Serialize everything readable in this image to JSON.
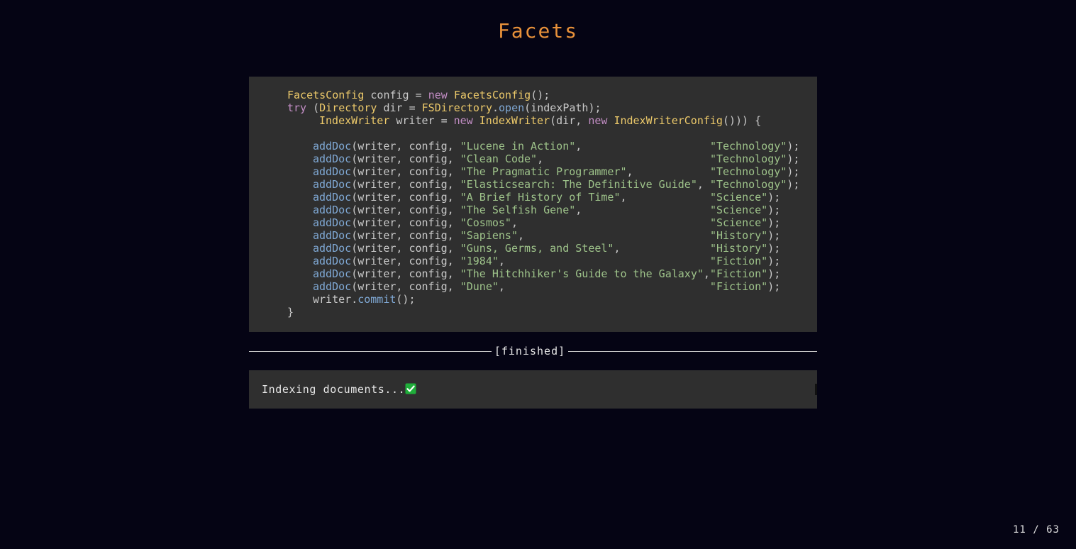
{
  "slide": {
    "title": "Facets",
    "page_counter": "11 / 63"
  },
  "code": {
    "line1": {
      "t1": "FacetsConfig",
      "p1": " config = ",
      "kw1": "new",
      "sp1": " ",
      "t2": "FacetsConfig",
      "p2": "();"
    },
    "line2": {
      "kw1": "try",
      "p1": " (",
      "t1": "Directory",
      "p2": " dir = ",
      "t2": "FSDirectory",
      "p3": ".",
      "f1": "open",
      "p4": "(indexPath);"
    },
    "line3": {
      "t1": "IndexWriter",
      "p1": " writer = ",
      "kw1": "new",
      "sp1": " ",
      "t2": "IndexWriter",
      "p2": "(dir, ",
      "kw2": "new",
      "sp2": " ",
      "t3": "IndexWriterConfig",
      "p3": "())) {"
    },
    "add_doc_fn": "addDoc",
    "add_doc_args": "(writer, config, ",
    "docs": [
      {
        "title": "\"Lucene in Action\"",
        "pad": ",                    ",
        "cat": "\"Technology\"",
        "end": ");"
      },
      {
        "title": "\"Clean Code\"",
        "pad": ",                          ",
        "cat": "\"Technology\"",
        "end": ");"
      },
      {
        "title": "\"The Pragmatic Programmer\"",
        "pad": ",            ",
        "cat": "\"Technology\"",
        "end": ");"
      },
      {
        "title": "\"Elasticsearch: The Definitive Guide\"",
        "pad": ", ",
        "cat": "\"Technology\"",
        "end": ");"
      },
      {
        "title": "\"A Brief History of Time\"",
        "pad": ",             ",
        "cat": "\"Science\"",
        "end": ");"
      },
      {
        "title": "\"The Selfish Gene\"",
        "pad": ",                    ",
        "cat": "\"Science\"",
        "end": ");"
      },
      {
        "title": "\"Cosmos\"",
        "pad": ",                              ",
        "cat": "\"Science\"",
        "end": ");"
      },
      {
        "title": "\"Sapiens\"",
        "pad": ",                             ",
        "cat": "\"History\"",
        "end": ");"
      },
      {
        "title": "\"Guns, Germs, and Steel\"",
        "pad": ",              ",
        "cat": "\"History\"",
        "end": ");"
      },
      {
        "title": "\"1984\"",
        "pad": ",                                ",
        "cat": "\"Fiction\"",
        "end": ");"
      },
      {
        "title": "\"The Hitchhiker's Guide to the Galaxy\"",
        "pad": ",",
        "cat": "\"Fiction\"",
        "end": ");"
      },
      {
        "title": "\"Dune\"",
        "pad": ",                                ",
        "cat": "\"Fiction\"",
        "end": ");"
      }
    ],
    "commit_line": {
      "p1": "writer",
      "p2": ".",
      "f1": "commit",
      "p3": "();"
    },
    "closing_brace": "}"
  },
  "run_status": {
    "label": "[finished]"
  },
  "output": {
    "text": "Indexing documents...",
    "status_icon": "check-mark-icon",
    "status_color": "#1fae3a"
  }
}
